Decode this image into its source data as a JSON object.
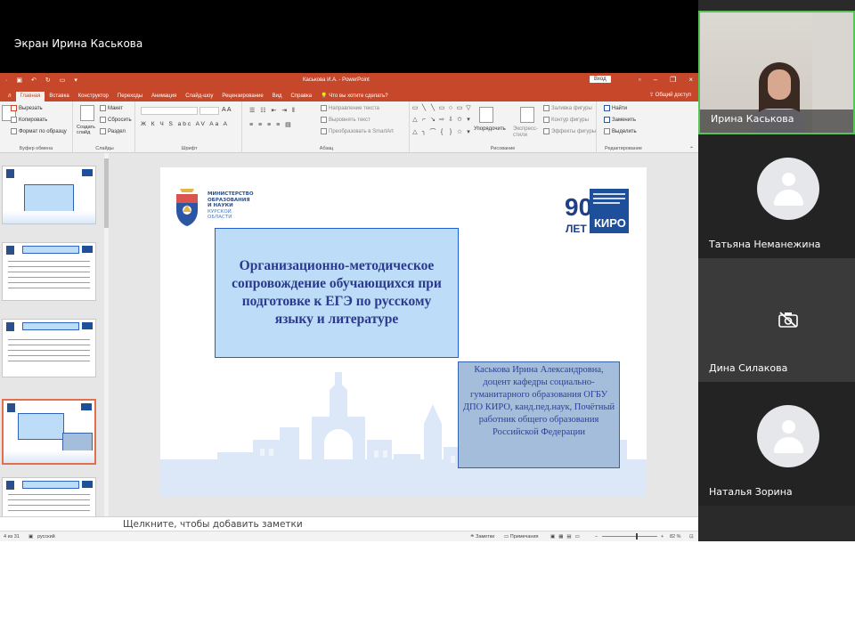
{
  "share_label": "Экран Ирина Каськова",
  "powerpoint": {
    "doc_title": "Каськова И.А. - PowerPoint",
    "signin_label": "Вход",
    "share_button": "Общий доступ",
    "tabs": [
      "Главная",
      "Вставка",
      "Конструктор",
      "Переходы",
      "Анимация",
      "Слайд-шоу",
      "Рецензирование",
      "Вид",
      "Справка"
    ],
    "file_tab": "л",
    "tell_me": "Что вы хотите сделать?",
    "ribbon": {
      "clipboard": {
        "cut": "Вырезать",
        "copy": "Копировать",
        "format_painter": "Формат по образцу",
        "paste": "Вставить",
        "group": "Буфер обмена"
      },
      "slides": {
        "layout": "Макет",
        "reset": "Сбросить",
        "section": "Раздел",
        "new_slide": "Создать слайд",
        "group": "Слайды"
      },
      "font": {
        "group": "Шрифт",
        "format_row": "Ж К Ч S abc AV Aa A"
      },
      "paragraph": {
        "text_direction": "Направление текста",
        "align_text": "Выровнять текст",
        "smartart": "Преобразовать в SmartArt",
        "group": "Абзац"
      },
      "drawing": {
        "arrange": "Упорядочить",
        "quick_styles": "Экспресс-стили",
        "fill": "Заливка фигуры",
        "outline": "Контур фигуры",
        "effects": "Эффекты фигуры",
        "group": "Рисование"
      },
      "editing": {
        "find": "Найти",
        "replace": "Заменить",
        "select": "Выделить",
        "group": "Редактирование"
      }
    },
    "thumbnails": [
      {
        "num": "1",
        "title": "Вебинар-практикум «Стратегии подготовки обучающихся к ЕГЭ по русскому языку и литературе»"
      },
      {
        "num": "2",
        "title": "Методические особенности обучающих ЕГЭ по русскому языку и литературе"
      },
      {
        "num": "3",
        "title": "Проведение вебинаров"
      },
      {
        "num": "4",
        "title": "Организационно-методическое сопровождение обучающихся при подготовке к ЕГЭ по русскому языку и литературе"
      },
      {
        "num": "5",
        "title": "Организационное и методическое сопровождение обучающихся при подготовке к ЕГЭ"
      }
    ],
    "slide": {
      "ministry": [
        "МИНИСТЕРСТВО",
        "ОБРАЗОВАНИЯ",
        "И НАУКИ",
        "КУРСКОЙ",
        "ОБЛАСТИ"
      ],
      "logo_years_num": "90",
      "logo_years_word": "ЛЕТ",
      "logo_org": "КИРО",
      "title": "Организационно-методическое сопровождение обучающихся при подготовке к ЕГЭ  по русскому языку и литературе",
      "author": "Каськова Ирина Александровна, доцент кафедры социально-гуманитарного образования ОГБУ ДПО КИРО, канд.пед.наук, Почётный работник общего образования Российской Федерации"
    },
    "notes_placeholder": "Щелкните, чтобы добавить заметки",
    "status": {
      "slide_counter": "4 из 31",
      "language": "русский",
      "notes": "Заметки",
      "comments": "Примечания",
      "zoom": "82 %"
    }
  },
  "participants": [
    {
      "name": "Ирина Каськова",
      "video": true,
      "active": true
    },
    {
      "name": "Татьяна Неманежина",
      "video": false
    },
    {
      "name": "Дина Силакова",
      "video": false,
      "camera_off_icon": true
    },
    {
      "name": "Наталья Зорина",
      "video": false
    }
  ]
}
